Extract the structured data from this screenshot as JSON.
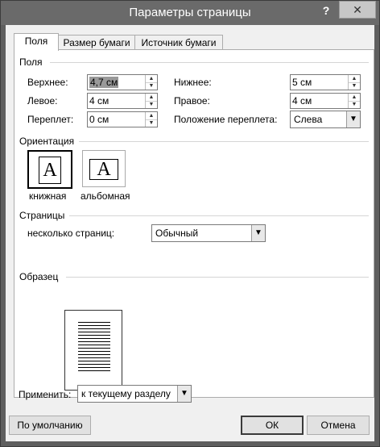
{
  "window": {
    "title": "Параметры страницы",
    "help": "?",
    "close": "✕"
  },
  "tabs": [
    "Поля",
    "Размер бумаги",
    "Источник бумаги"
  ],
  "margins": {
    "group_label": "Поля",
    "top_label": "Верхнее:",
    "top_value": "4,7 см",
    "bottom_label": "Нижнее:",
    "bottom_value": "5 см",
    "left_label": "Левое:",
    "left_value": "4 см",
    "right_label": "Правое:",
    "right_value": "4 см",
    "gutter_label": "Переплет:",
    "gutter_value": "0 см",
    "gutter_pos_label": "Положение переплета:",
    "gutter_pos_value": "Слева"
  },
  "orientation": {
    "group_label": "Ориентация",
    "portrait_label": "книжная",
    "landscape_label": "альбомная",
    "icon_letter": "A",
    "selected": "portrait"
  },
  "pages": {
    "group_label": "Страницы",
    "multiple_label": "несколько страниц:",
    "multiple_value": "Обычный"
  },
  "preview": {
    "group_label": "Образец"
  },
  "apply": {
    "label": "Применить:",
    "value": "к текущему разделу"
  },
  "buttons": {
    "default": "По умолчанию",
    "ok": "ОК",
    "cancel": "Отмена"
  },
  "icons": {
    "spin_up": "▲",
    "spin_down": "▼",
    "dropdown": "▼"
  }
}
